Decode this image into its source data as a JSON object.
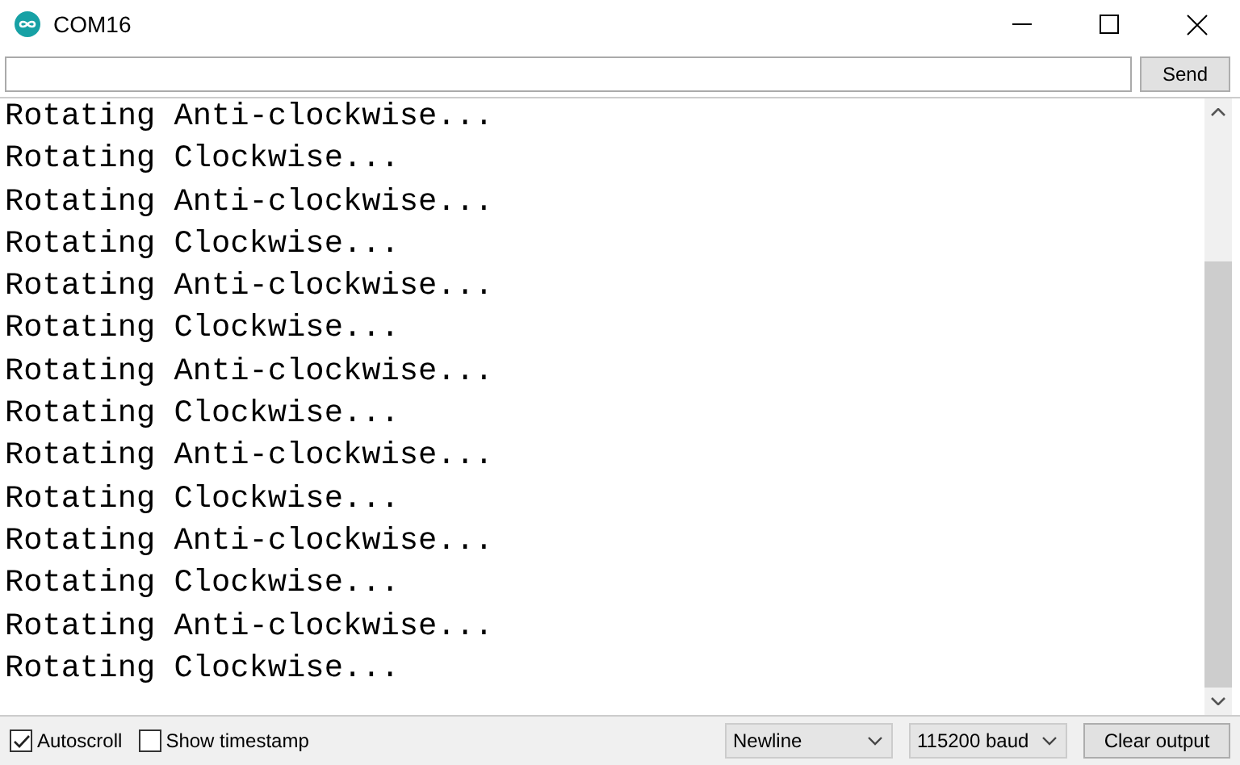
{
  "window": {
    "title": "COM16"
  },
  "send_button": "Send",
  "output_lines": [
    "Rotating Anti-clockwise...",
    "Rotating Clockwise...",
    "Rotating Anti-clockwise...",
    "Rotating Clockwise...",
    "Rotating Anti-clockwise...",
    "Rotating Clockwise...",
    "Rotating Anti-clockwise...",
    "Rotating Clockwise...",
    "Rotating Anti-clockwise...",
    "Rotating Clockwise...",
    "Rotating Anti-clockwise...",
    "Rotating Clockwise...",
    "Rotating Anti-clockwise...",
    "Rotating Clockwise..."
  ],
  "options": [
    {
      "label": "Autoscroll",
      "checked": true
    },
    {
      "label": "Show timestamp",
      "checked": false
    }
  ],
  "line_ending": "Newline",
  "baud_rate": "115200 baud",
  "clear_button": "Clear output"
}
